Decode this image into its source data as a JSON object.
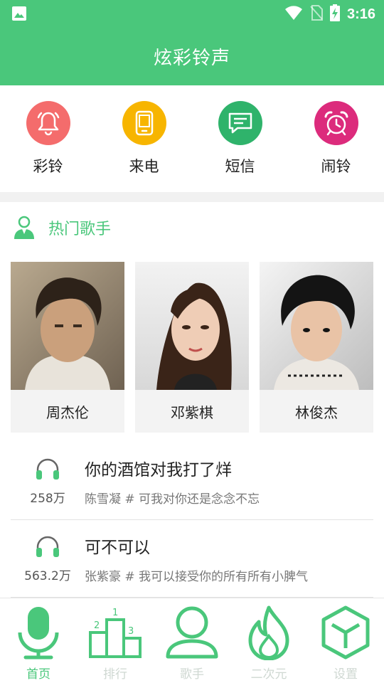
{
  "status_bar": {
    "time": "3:16"
  },
  "app_bar": {
    "title": "炫彩铃声"
  },
  "quick_actions": [
    {
      "label": "彩铃",
      "icon": "bell-icon",
      "color": "#f46c6c"
    },
    {
      "label": "来电",
      "icon": "phone-icon",
      "color": "#f7b500"
    },
    {
      "label": "短信",
      "icon": "message-icon",
      "color": "#2fb36b"
    },
    {
      "label": "闹铃",
      "icon": "alarm-clock-icon",
      "color": "#dc2b7c"
    }
  ],
  "hot_singers": {
    "title": "热门歌手",
    "items": [
      {
        "name": "周杰伦"
      },
      {
        "name": "邓紫棋"
      },
      {
        "name": "林俊杰"
      }
    ]
  },
  "songs": [
    {
      "title": "你的酒馆对我打了烊",
      "subtitle": "陈雪凝 # 可我对你还是念念不忘",
      "plays": "258万"
    },
    {
      "title": "可不可以",
      "subtitle": "张紫豪 # 我可以接受你的所有所有小脾气",
      "plays": "563.2万"
    }
  ],
  "tabs": [
    {
      "label": "首页",
      "icon": "microphone-icon",
      "active": true
    },
    {
      "label": "排行",
      "icon": "podium-icon",
      "active": false
    },
    {
      "label": "歌手",
      "icon": "person-icon",
      "active": false
    },
    {
      "label": "二次元",
      "icon": "flame-icon",
      "active": false
    },
    {
      "label": "设置",
      "icon": "cube-icon",
      "active": false
    }
  ],
  "colors": {
    "brand": "#4ac77b",
    "inactive_tab": "#cfd8d2"
  }
}
